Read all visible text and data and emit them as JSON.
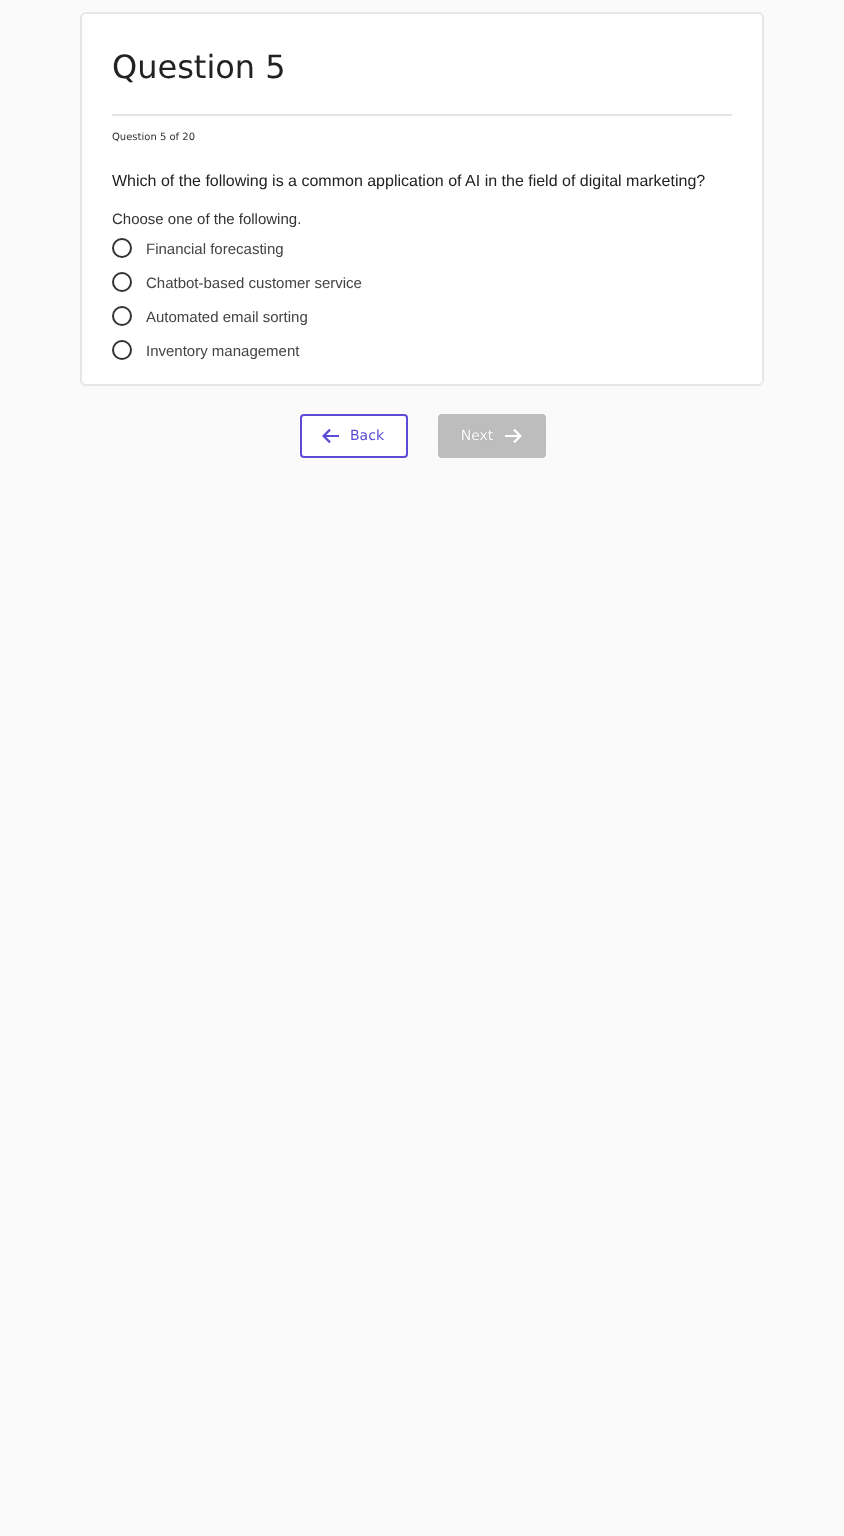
{
  "title": "Question 5",
  "progress": "Question 5 of 20",
  "question": "Which of the following is a common application of AI in the field of digital marketing?",
  "instruction": "Choose one of the following.",
  "options": [
    {
      "label": "Financial forecasting",
      "selected": false
    },
    {
      "label": "Chatbot-based customer service",
      "selected": false
    },
    {
      "label": "Automated email sorting",
      "selected": false
    },
    {
      "label": "Inventory management",
      "selected": false
    }
  ],
  "buttons": [
    {
      "kind": "back",
      "label": "Back",
      "disabled": false
    },
    {
      "kind": "next",
      "label": "Next",
      "disabled": true
    }
  ]
}
